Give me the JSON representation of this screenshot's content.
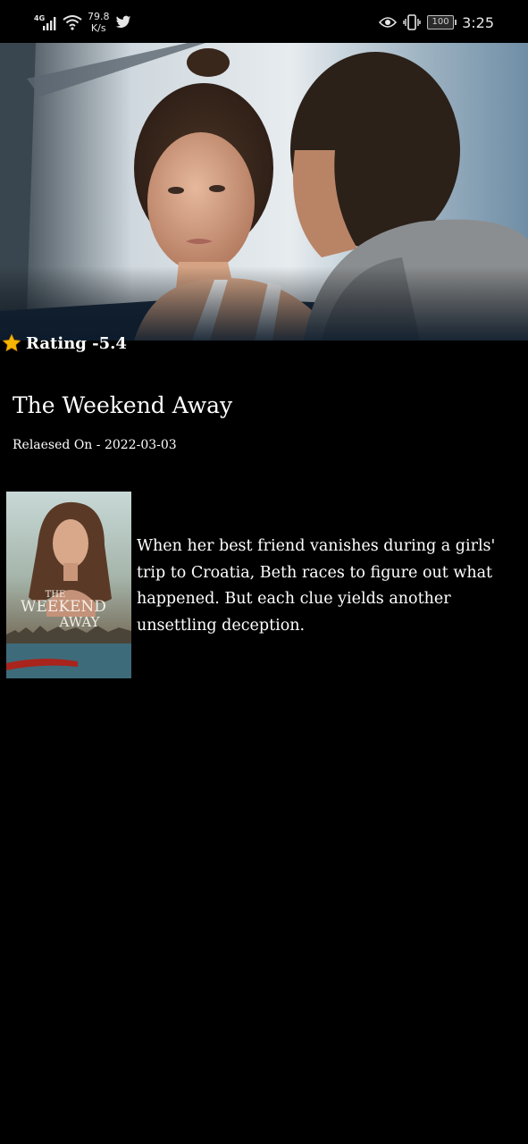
{
  "status_bar": {
    "network": "4G",
    "speed_value": "79.8",
    "speed_unit": "K/s",
    "battery": "100",
    "time": "3:25"
  },
  "movie": {
    "rating_label": "Rating -",
    "rating": "5.4",
    "title": "The Weekend Away",
    "release_label": "Relaesed On - ",
    "release_date": "2022-03-03",
    "overview": "When her best friend vanishes during a girls' trip to Croatia, Beth races to figure out what happened. But each clue yields another unsettling deception.",
    "poster_title_line1": "THE",
    "poster_title_line2": "WEEKEND",
    "poster_title_line3": "AWAY"
  },
  "colors": {
    "background": "#000000",
    "text": "#ffffff",
    "star": "#f5b400"
  },
  "icons": [
    "signal-icon",
    "wifi-icon",
    "twitter-icon",
    "eye-icon",
    "vibrate-icon",
    "battery-icon",
    "star-icon"
  ]
}
